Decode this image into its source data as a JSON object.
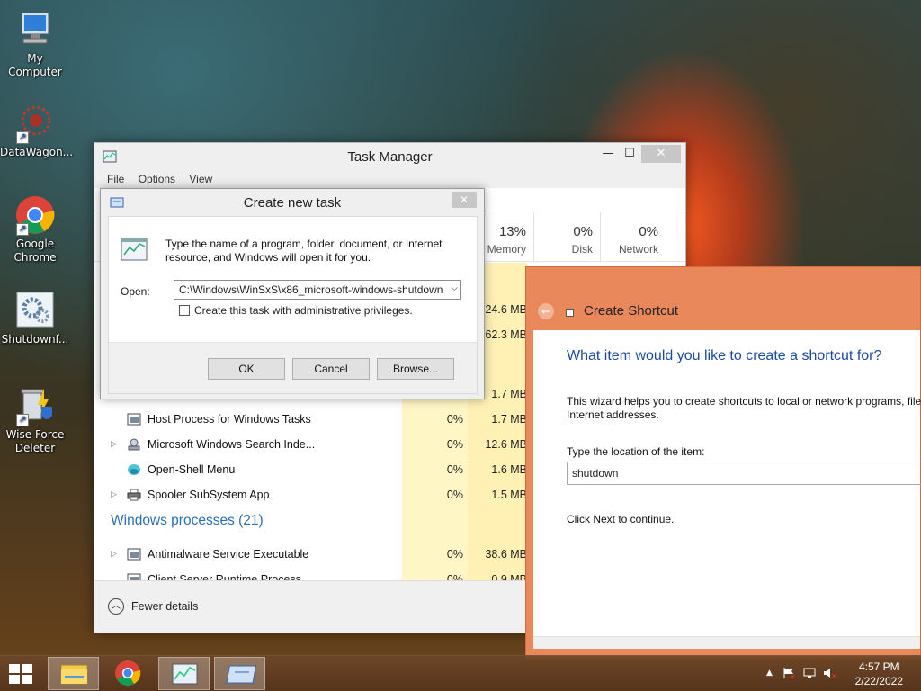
{
  "desktop": {
    "icons": [
      {
        "label": "My Computer",
        "icon": "computer-icon"
      },
      {
        "label": "DataWagon...",
        "icon": "datawagon-icon"
      },
      {
        "label": "Google Chrome",
        "icon": "chrome-icon"
      },
      {
        "label": "Shutdownf...",
        "icon": "gears-icon"
      },
      {
        "label": "Wise Force Deleter",
        "icon": "recycle-bin-shield-icon"
      }
    ]
  },
  "task_manager": {
    "title": "Task Manager",
    "minimize_glyph": "—",
    "maximize_glyph": "☐",
    "close_glyph": "✕",
    "menu": [
      "File",
      "Options",
      "View"
    ],
    "columns": [
      {
        "pct": "13%",
        "label": "Memory"
      },
      {
        "pct": "0%",
        "label": "Disk"
      },
      {
        "pct": "0%",
        "label": "Network"
      }
    ],
    "partial_mem_values": [
      "24.6 MB",
      "62.3 MB",
      "1.7 MB"
    ],
    "rows": [
      {
        "expand": "",
        "name": "Host Process for Windows Tasks",
        "cpu": "0%",
        "mem": "1.7 MB"
      },
      {
        "expand": "▷",
        "name": "Microsoft Windows Search Inde...",
        "cpu": "0%",
        "mem": "12.6 MB"
      },
      {
        "expand": "",
        "name": "Open-Shell Menu",
        "cpu": "0%",
        "mem": "1.6 MB"
      },
      {
        "expand": "▷",
        "name": "Spooler SubSystem App",
        "cpu": "0%",
        "mem": "1.5 MB"
      }
    ],
    "group_title": "Windows processes (21)",
    "rows2": [
      {
        "expand": "▷",
        "name": "Antimalware Service Executable",
        "cpu": "0%",
        "mem": "38.6 MB"
      },
      {
        "expand": "",
        "name": "Client Server Runtime Process",
        "cpu": "0%",
        "mem": "0.9 MB"
      }
    ],
    "fewer_details": "Fewer details"
  },
  "create_new_task": {
    "title": "Create new task",
    "close_glyph": "✕",
    "description": "Type the name of a program, folder, document, or Internet resource, and Windows will open it for you.",
    "open_label": "Open:",
    "open_value": "C:\\Windows\\WinSxS\\x86_microsoft-windows-shutdown",
    "admin_checkbox_label": "Create this task with administrative privileges.",
    "ok_label": "OK",
    "cancel_label": "Cancel",
    "browse_label": "Browse..."
  },
  "create_shortcut": {
    "title": "Create Shortcut",
    "heading": "What item would you like to create a shortcut for?",
    "intro_line1": "This wizard helps you to create shortcuts to local or network programs, files,",
    "intro_line2": "Internet addresses.",
    "location_label": "Type the location of the item:",
    "location_value": "shutdown",
    "next_hint": "Click Next to continue."
  },
  "taskbar": {
    "time": "4:57 PM",
    "date": "2/22/2022",
    "tray_up_glyph": "▲"
  }
}
